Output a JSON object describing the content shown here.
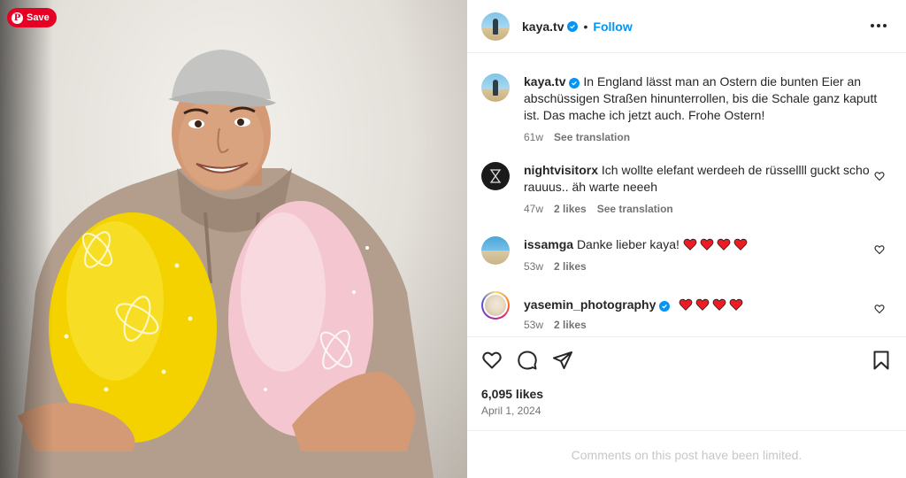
{
  "pin_save": {
    "label": "Save",
    "logo": "P",
    "color": "#e60023"
  },
  "post": {
    "author": "kaya.tv",
    "follow_label": "Follow",
    "separator": "•",
    "caption": "In England lässt man an Ostern die bunten Eier an abschüssigen Straßen hinunterrollen, bis die Schale ganz kaputt ist. Das mache ich jetzt auch. Frohe Ostern!",
    "caption_age": "61w",
    "see_translation": "See translation",
    "likes": "6,095 likes",
    "date": "April 1, 2024",
    "comments_limited": "Comments on this post have been limited."
  },
  "comments": [
    {
      "user": "nightvisitorx",
      "text": "Ich wollte elefant werdeeh de rüssellll guckt scho rauuus.. äh warte neeeh",
      "age": "47w",
      "likes": "2 likes",
      "translate": "See translation"
    },
    {
      "user": "issamga",
      "text": "Danke lieber kaya!",
      "hearts": 4,
      "age": "53w",
      "likes": "2 likes"
    },
    {
      "user": "yasemin_photography",
      "text": "",
      "hearts": 4,
      "verified": true,
      "age": "53w",
      "likes": "2 likes"
    }
  ],
  "icons": {
    "like": "heart-icon",
    "comment": "comment-icon",
    "share": "paper-plane-icon",
    "save": "bookmark-icon",
    "more": "more-options-icon",
    "verified": "verified-badge-icon"
  },
  "colors": {
    "accent": "#0095f6",
    "heart": "#ed1c24",
    "muted": "#737373"
  }
}
